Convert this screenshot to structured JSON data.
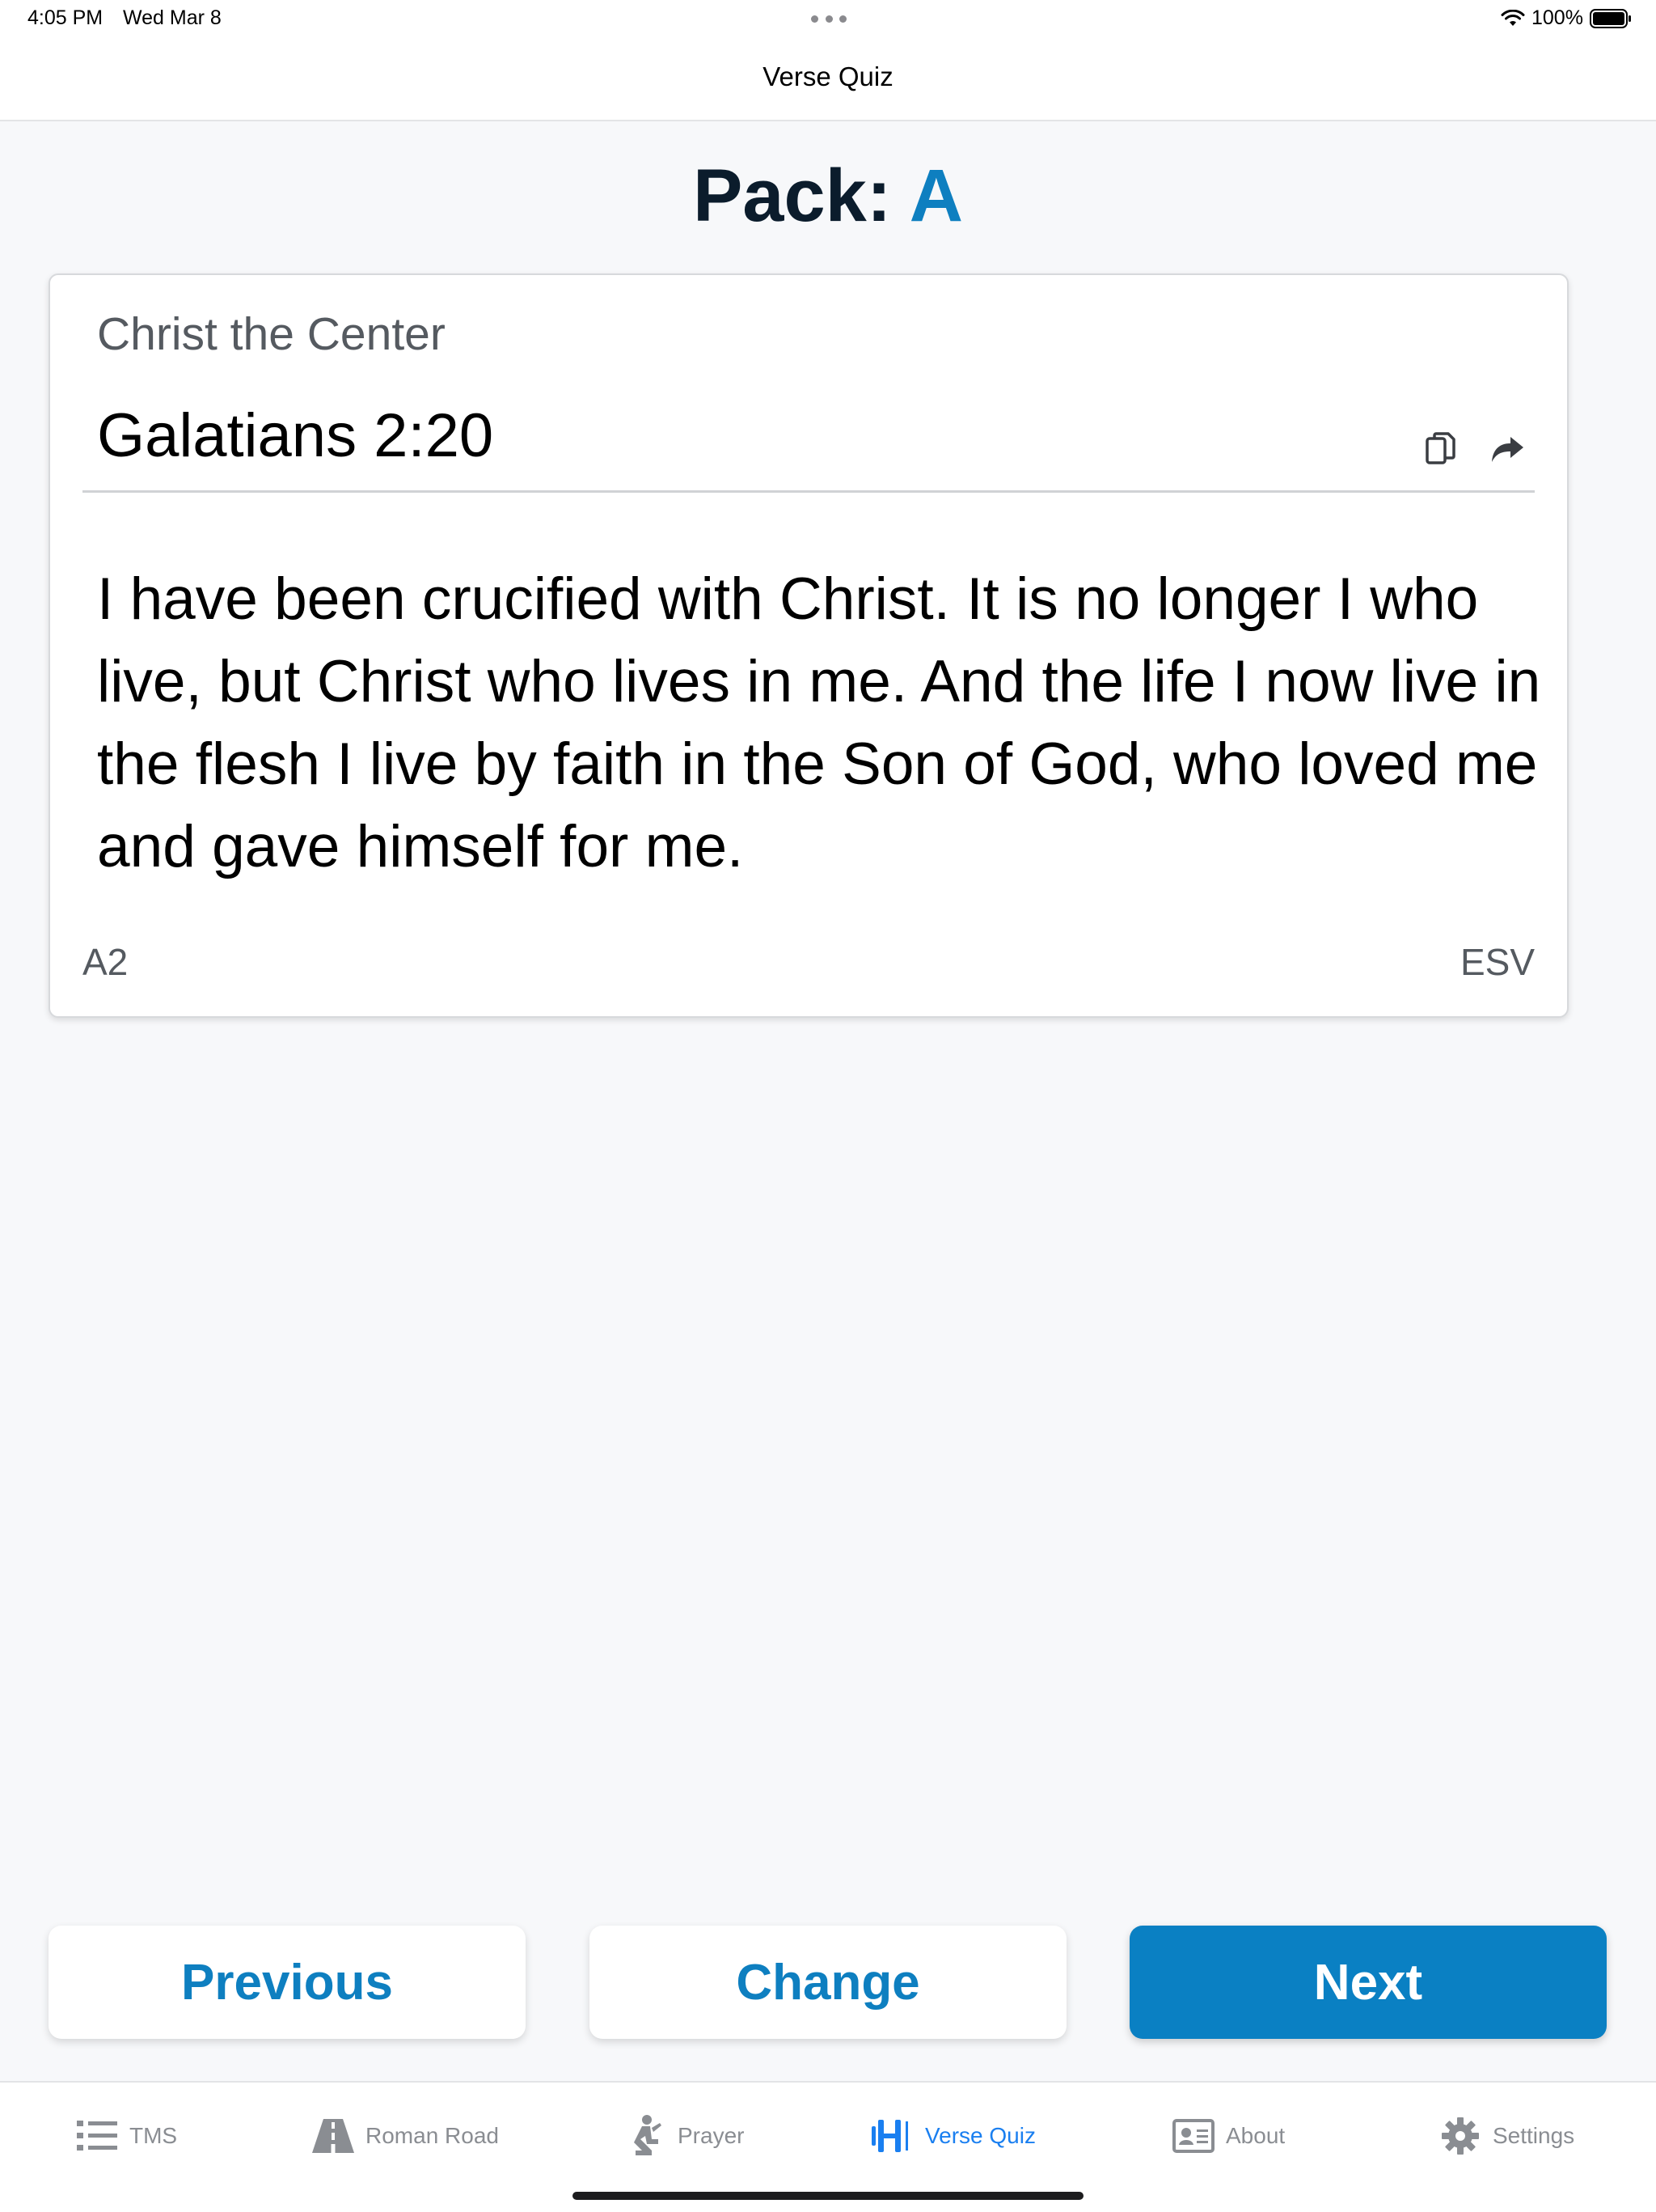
{
  "status_bar": {
    "time": "4:05 PM",
    "date": "Wed Mar 8",
    "battery_percent": "100%",
    "battery_level": 1.0
  },
  "nav": {
    "title": "Verse Quiz"
  },
  "pack": {
    "label": "Pack:",
    "value": "A"
  },
  "card": {
    "topic": "Christ the Center",
    "reference": "Galatians 2:20",
    "verse_text": "I have been crucified with Christ. It is no longer I who live, but Christ who lives in me. And the life I now live in the flesh I live by faith in the Son of God, who loved me and gave himself for me.",
    "code": "A2",
    "translation": "ESV"
  },
  "buttons": {
    "previous": "Previous",
    "change": "Change",
    "next": "Next"
  },
  "tabs": [
    {
      "label": "TMS",
      "icon": "list-icon",
      "active": false
    },
    {
      "label": "Roman Road",
      "icon": "road-icon",
      "active": false
    },
    {
      "label": "Prayer",
      "icon": "kneeling-person-icon",
      "active": false
    },
    {
      "label": "Verse Quiz",
      "icon": "quiz-icon",
      "active": true
    },
    {
      "label": "About",
      "icon": "id-card-icon",
      "active": false
    },
    {
      "label": "Settings",
      "icon": "gear-icon",
      "active": false
    }
  ],
  "colors": {
    "accent": "#0e7fc0",
    "primary_button": "#0a80c3",
    "active_tab": "#1a7ff0",
    "inactive_tab": "#8a8d92",
    "heading_dark": "#0b1c2c"
  }
}
